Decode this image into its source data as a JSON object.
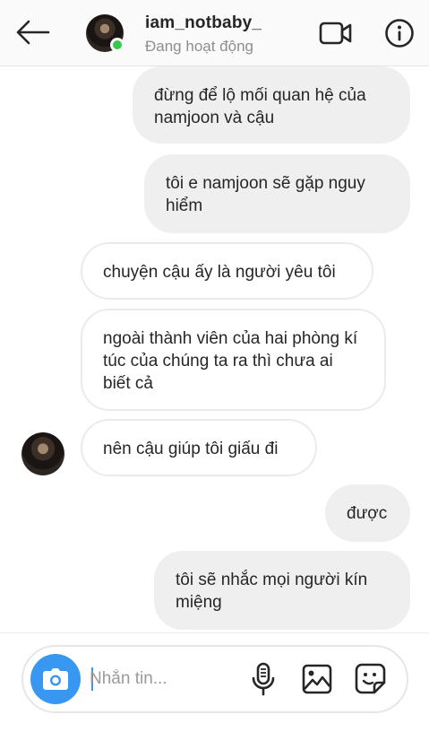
{
  "header": {
    "username": "iam_notbaby_",
    "status": "Đang hoạt động",
    "back_icon": "arrow-left-icon",
    "video_icon": "video-call-icon",
    "info_icon": "info-icon",
    "online_color": "#37c94c"
  },
  "messages": [
    {
      "direction": "outgoing",
      "text": "đừng để lộ mối quan hệ của namjoon và cậu"
    },
    {
      "direction": "outgoing",
      "text": "tôi e namjoon sẽ gặp nguy hiểm"
    },
    {
      "direction": "incoming",
      "text": "chuyện cậu ấy là người yêu tôi"
    },
    {
      "direction": "incoming",
      "text": "ngoài thành viên của hai phòng kí túc của chúng ta ra thì chưa ai biết cả"
    },
    {
      "direction": "incoming",
      "text": "nên cậu giúp tôi giấu đi"
    },
    {
      "direction": "outgoing",
      "text": "được"
    },
    {
      "direction": "outgoing",
      "text": "tôi sẽ nhắc mọi người kín miệng"
    }
  ],
  "composer": {
    "placeholder": "Nhắn tin...",
    "value": "",
    "camera_icon": "camera-icon",
    "mic_icon": "microphone-icon",
    "gallery_icon": "image-gallery-icon",
    "sticker_icon": "sticker-icon",
    "accent_color": "#3897f0"
  }
}
